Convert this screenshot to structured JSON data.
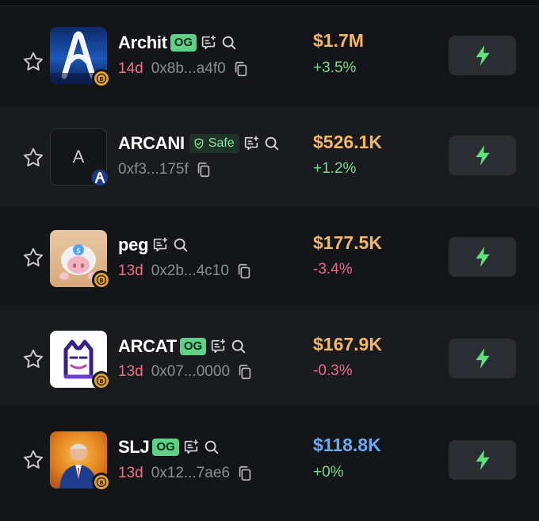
{
  "tokens": [
    {
      "name": "Archit",
      "tag": "OG",
      "age": "14d",
      "address": "0x8b...a4f0",
      "price": "$1.7M",
      "change": "+3.5%"
    },
    {
      "name": "ARCANI",
      "tag": "Safe",
      "age": "",
      "address": "0xf3...175f",
      "price": "$526.1K",
      "change": "+1.2%",
      "avatar_letter": "A"
    },
    {
      "name": "peg",
      "tag": "",
      "age": "13d",
      "address": "0x2b...4c10",
      "price": "$177.5K",
      "change": "-3.4%"
    },
    {
      "name": "ARCAT",
      "tag": "OG",
      "age": "13d",
      "address": "0x07...0000",
      "price": "$167.9K",
      "change": "-0.3%"
    },
    {
      "name": "SLJ",
      "tag": "OG",
      "age": "13d",
      "address": "0x12...7ae6",
      "price": "$118.8K",
      "change": "+0%"
    }
  ],
  "icons": {
    "favorite": "star-outline-icon",
    "notes": "notes-sparkle-icon",
    "search": "search-icon",
    "copy": "copy-icon",
    "quick_buy": "lightning-icon"
  },
  "colors": {
    "og_tag": "#5fd087",
    "safe_tag": "#8fe3a6",
    "price": "#f5b765",
    "price_low": "#6aaaf5",
    "positive": "#74dc8e",
    "negative": "#f0678a",
    "age": "#f06f8a",
    "bolt": "#5ee07a"
  }
}
